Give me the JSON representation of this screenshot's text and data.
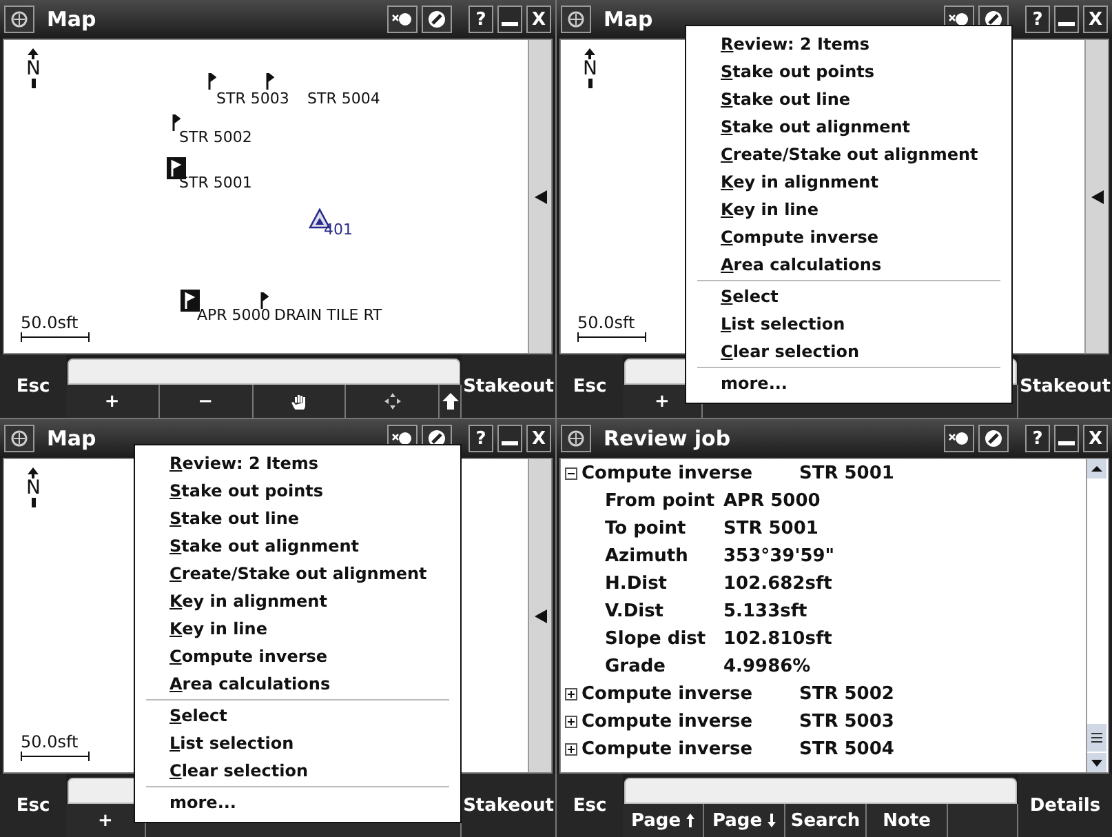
{
  "panels": [
    {
      "kind": "map",
      "title": "Map",
      "help": "?",
      "close": "X",
      "north": "N",
      "scale": "50.0sft",
      "esc": "Esc",
      "action": "Stakeout",
      "points": [
        {
          "label": "STR 5003",
          "kind": "flag",
          "selected": false
        },
        {
          "label": "STR 5004",
          "kind": "flag",
          "selected": false
        },
        {
          "label": "STR 5002",
          "kind": "flag",
          "selected": false
        },
        {
          "label": "STR 5001",
          "kind": "flag",
          "selected": true
        },
        {
          "label": "401",
          "kind": "control",
          "selected": false
        },
        {
          "label": "APR 5000",
          "kind": "flag",
          "selected": true
        },
        {
          "label": "DRAIN TILE RT",
          "kind": "flag",
          "selected": false
        }
      ],
      "toolbar": [
        {
          "kind": "text",
          "label": "+"
        },
        {
          "kind": "text",
          "label": "−"
        },
        {
          "kind": "hand"
        },
        {
          "kind": "pan"
        },
        {
          "kind": "up"
        }
      ]
    },
    {
      "kind": "map",
      "title": "Map",
      "help": "?",
      "close": "X",
      "north": "N",
      "scale": "50.0sft",
      "esc": "Esc",
      "action": "Stakeout",
      "toolbar": [
        {
          "kind": "text",
          "label": "+"
        }
      ],
      "menu": [
        [
          "Review: 2 Items",
          "Stake out points",
          "Stake out line",
          "Stake out alignment",
          "Create/Stake out alignment",
          "Key in alignment",
          "Key in line",
          "Compute inverse",
          "Area calculations"
        ],
        [
          "Select",
          "List selection",
          "Clear selection"
        ],
        [
          "more..."
        ]
      ]
    },
    {
      "kind": "map",
      "title": "Map",
      "help": "?",
      "close": "X",
      "north": "N",
      "scale": "50.0sft",
      "esc": "Esc",
      "action": "Stakeout",
      "toolbar": [
        {
          "kind": "text",
          "label": "+"
        }
      ],
      "menu": [
        [
          "Review: 2 Items",
          "Stake out points",
          "Stake out line",
          "Stake out alignment",
          "Create/Stake out alignment",
          "Key in alignment",
          "Key in line",
          "Compute inverse",
          "Area calculations"
        ],
        [
          "Select",
          "List selection",
          "Clear selection"
        ],
        [
          "more..."
        ]
      ]
    },
    {
      "kind": "review",
      "title": "Review job",
      "help": "?",
      "close": "X",
      "esc": "Esc",
      "action": "Details",
      "tree": [
        {
          "label": "Compute inverse",
          "value": "STR 5001",
          "expanded": true,
          "children": [
            {
              "label": "From point",
              "value": "APR 5000"
            },
            {
              "label": "To point",
              "value": "STR 5001"
            },
            {
              "label": "Azimuth",
              "value": "353°39'59\""
            },
            {
              "label": "H.Dist",
              "value": "102.682sft"
            },
            {
              "label": "V.Dist",
              "value": "5.133sft"
            },
            {
              "label": "Slope dist",
              "value": "102.810sft"
            },
            {
              "label": "Grade",
              "value": "4.9986%"
            }
          ]
        },
        {
          "label": "Compute inverse",
          "value": "STR 5002",
          "expanded": false
        },
        {
          "label": "Compute inverse",
          "value": "STR 5003",
          "expanded": false
        },
        {
          "label": "Compute inverse",
          "value": "STR 5004",
          "expanded": false
        }
      ],
      "toolbar": [
        {
          "kind": "page_up",
          "label": "Page"
        },
        {
          "kind": "page_down",
          "label": "Page"
        },
        {
          "kind": "text",
          "label": "Search"
        },
        {
          "kind": "text",
          "label": "Note"
        },
        {
          "kind": "blank"
        }
      ]
    }
  ]
}
